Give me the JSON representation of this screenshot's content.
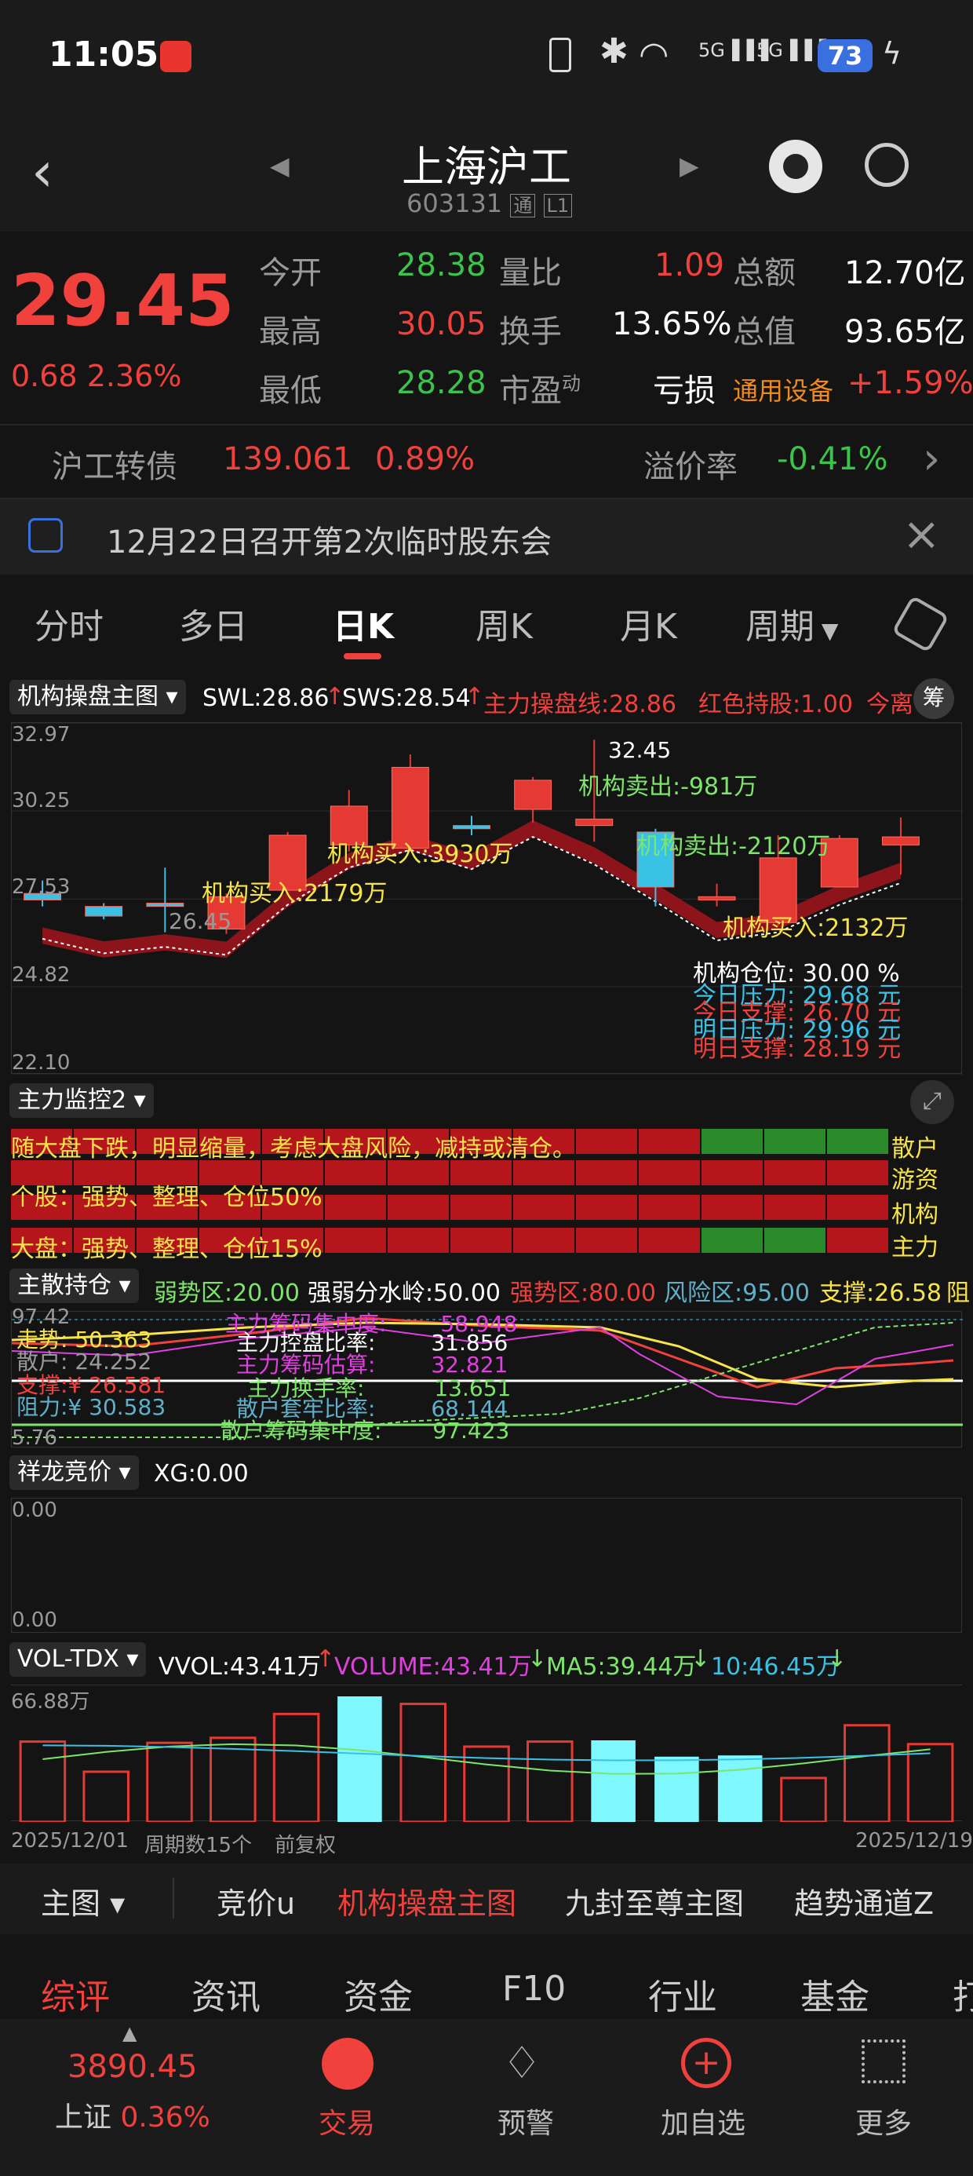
{
  "status": {
    "time": "11:05",
    "battery": "73",
    "signal1": "5G",
    "signal2": "5G"
  },
  "header": {
    "title": "上海沪工",
    "code": "603131",
    "badge1": "通",
    "badge2": "L1"
  },
  "quote": {
    "price": "29.45",
    "change": "0.68",
    "change_pct": "2.36%",
    "open_label": "今开",
    "open": "28.38",
    "high_label": "最高",
    "high": "30.05",
    "low_label": "最低",
    "low": "28.28",
    "vr_label": "量比",
    "vr": "1.09",
    "turnover_label": "换手",
    "turnover": "13.65%",
    "pe_label": "市盈",
    "pe_sup": "动",
    "pe": "亏损",
    "amount_label": "总额",
    "amount": "12.70亿",
    "mktcap_label": "总值",
    "mktcap": "93.65亿",
    "sector": "通用设备",
    "sector_pct": "+1.59%"
  },
  "bond": {
    "label": "沪工转债",
    "price": "139.061",
    "pct": "0.89%",
    "premium_label": "溢价率",
    "premium": "-0.41%"
  },
  "notice": {
    "text": "12月22日召开第2次临时股东会"
  },
  "tabs": [
    "分时",
    "多日",
    "日K",
    "周K",
    "月K",
    "周期"
  ],
  "main_chart": {
    "name": "机构操盘主图",
    "swl": "SWL:28.86",
    "sws": "SWS:28.54",
    "zl": "主力操盘线:28.86",
    "hold": "红色持股:1.00",
    "tail": "今离",
    "chip": "筹",
    "yticks": [
      "32.97",
      "30.25",
      "27.53",
      "24.82",
      "22.10"
    ],
    "peak": "32.45",
    "trough": "26.45",
    "ann_buy1": "机构买入:2179万",
    "ann_buy2": "机构买入:3930万",
    "ann_sell1": "机构卖出:-981万",
    "ann_sell2": "机构卖出:-2120万",
    "ann_buy3": "机构买入:2132万",
    "pos_label": "机构仓位:",
    "pos_val": "30.00 %",
    "p1_label": "今日压力:",
    "p1_val": "29.68 元",
    "p2_label": "今日支撑:",
    "p2_val": "26.70 元",
    "p3_label": "明日压力:",
    "p3_val": "29.96 元",
    "p4_label": "明日支撑:",
    "p4_val": "28.19 元"
  },
  "monitor": {
    "name": "主力监控2",
    "line1": "随大盘下跌，明显缩量，考虑大盘风险，减持或清仓。",
    "line2": "个股：强势、整理、仓位50%",
    "line3": "大盘：强势、整理、仓位15%",
    "labels": [
      "散户",
      "游资",
      "机构",
      "主力"
    ]
  },
  "hold": {
    "name": "主散持仓",
    "weak": "弱势区:20.00",
    "div": "强弱分水岭:50.00",
    "strong": "强势区:80.00",
    "risk": "风险区:95.00",
    "support": "支撑:26.58",
    "tail": "阻",
    "ytop": "97.42",
    "ybot": "5.76",
    "r1l": "走势:",
    "r1v": "50.363",
    "r2l": "散户:",
    "r2v": "24.252",
    "r3l": "支撑:¥",
    "r3v": "26.581",
    "r4l": "阻力:¥",
    "r4v": "30.583",
    "m0l": "主力筹码集中度:",
    "m0v": "58.948",
    "m1l": "主力控盘比率:",
    "m1v": "31.856",
    "m2l": "主力筹码估算:",
    "m2v": "32.821",
    "m3l": "主力换手率:",
    "m3v": "13.651",
    "m4l": "散户套牢比率:",
    "m4v": "68.144",
    "m5l": "散户筹码集中度:",
    "m5v": "97.423"
  },
  "xl": {
    "name": "祥龙竞价",
    "xg": "XG:0.00",
    "ytop": "0.00",
    "ybot": "0.00"
  },
  "vol": {
    "name": "VOL-TDX",
    "vvol": "VVOL:43.41万",
    "volume": "VOLUME:43.41万",
    "ma5": "MA5:39.44万",
    "ma10": "10:46.45万",
    "ytop": "66.88万",
    "bars": [
      0.64,
      0.4,
      0.63,
      0.67,
      0.86,
      1.0,
      0.94,
      0.6,
      0.64,
      0.65,
      0.52,
      0.53,
      0.35,
      0.77,
      0.62
    ],
    "cyan": [
      false,
      false,
      false,
      false,
      false,
      true,
      false,
      false,
      false,
      true,
      true,
      true,
      false,
      false,
      false
    ]
  },
  "footer_axis": {
    "start": "2025/12/01",
    "count": "周期数15个",
    "adj": "前复权",
    "end": "2025/12/19"
  },
  "indicator_tabs": [
    "主图",
    "竞价u",
    "机构操盘主图",
    "九封至尊主图",
    "趋势通道Z"
  ],
  "info_tabs": [
    "综评",
    "资讯",
    "资金",
    "F10",
    "行业",
    "基金",
    "打"
  ],
  "bottom": {
    "index_val": "3890.45",
    "index_name": "上证",
    "index_pct": "0.36%",
    "trade": "交易",
    "alert": "预警",
    "add": "加自选",
    "more": "更多"
  },
  "chart_data": [
    {
      "type": "candlestick",
      "title": "机构操盘主图",
      "ylim": [
        22.1,
        32.97
      ],
      "yticks": [
        32.97,
        30.25,
        27.53,
        24.82,
        22.1
      ],
      "x": [
        "2025/12/01",
        "",
        "",
        "",
        "",
        "",
        "",
        "",
        "",
        "",
        "",
        "",
        "",
        "",
        "2025/12/19"
      ],
      "candles": [
        [
          27.7,
          27.5,
          28.1,
          27.3
        ],
        [
          27.3,
          27.0,
          27.4,
          26.9
        ],
        [
          27.4,
          27.3,
          28.5,
          26.5
        ],
        [
          26.6,
          27.6,
          27.7,
          26.45
        ],
        [
          27.8,
          29.5,
          29.6,
          27.8
        ],
        [
          29.2,
          30.4,
          30.9,
          29.0
        ],
        [
          29.1,
          31.6,
          32.0,
          29.0
        ],
        [
          29.8,
          29.7,
          30.1,
          29.5
        ],
        [
          30.3,
          31.2,
          31.3,
          29.9
        ],
        [
          29.8,
          30.0,
          32.45,
          29.3
        ],
        [
          29.6,
          27.9,
          29.7,
          27.3
        ],
        [
          27.5,
          27.6,
          28.0,
          27.3
        ],
        [
          26.8,
          28.8,
          29.5,
          26.7
        ],
        [
          27.9,
          29.4,
          29.5,
          27.9
        ],
        [
          29.2,
          29.45,
          30.05,
          28.28
        ]
      ]
    },
    {
      "type": "bar",
      "title": "VOL-TDX",
      "ylim": [
        0,
        66.88
      ],
      "values": [
        42.8,
        26.7,
        42.1,
        44.8,
        57.5,
        66.88,
        62.9,
        40.1,
        42.8,
        43.5,
        34.8,
        35.4,
        23.4,
        51.5,
        43.41
      ]
    }
  ]
}
